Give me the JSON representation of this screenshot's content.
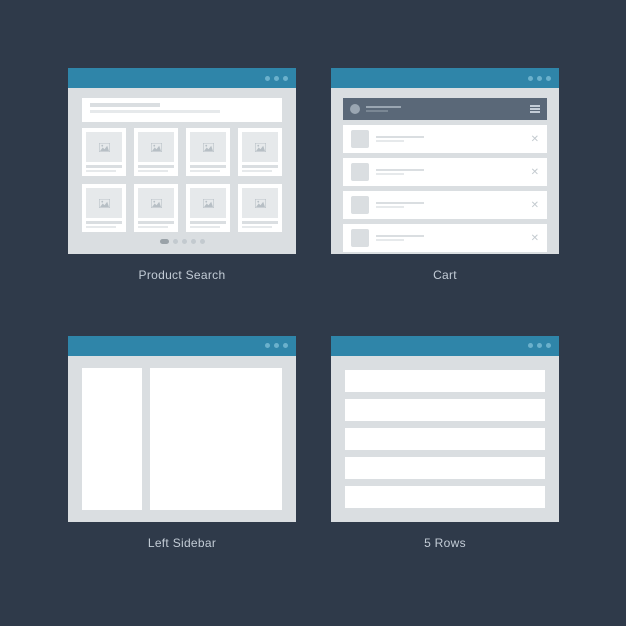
{
  "wireframes": {
    "productSearch": {
      "label": "Product Search",
      "cards": 8,
      "pagerDots": 5
    },
    "cart": {
      "label": "Cart",
      "items": 4
    },
    "leftSidebar": {
      "label": "Left Sidebar"
    },
    "fiveRows": {
      "label": "5 Rows",
      "rows": 5
    }
  },
  "colors": {
    "bg": "#2f3a4a",
    "titlebar": "#2f85a9",
    "panel": "#dadee1",
    "cartHeader": "#5a6878"
  }
}
